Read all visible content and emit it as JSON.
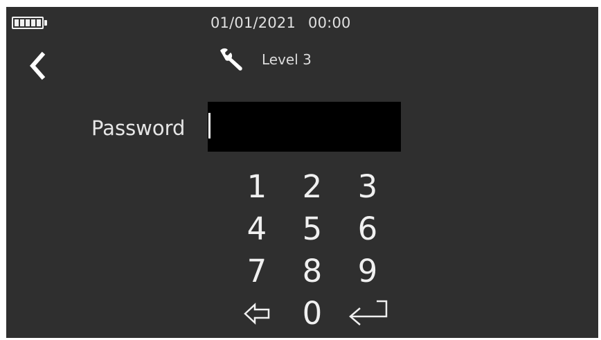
{
  "status_bar": {
    "battery_icon": "battery-full-icon",
    "date": "01/01/2021",
    "time": "00:00"
  },
  "header": {
    "back_icon": "chevron-left-icon",
    "level_icon": "wrench-icon",
    "level_label": "Level 3"
  },
  "password": {
    "label": "Password",
    "value": ""
  },
  "keypad": {
    "keys": [
      "1",
      "2",
      "3",
      "4",
      "5",
      "6",
      "7",
      "8",
      "9"
    ],
    "zero": "0",
    "backspace_icon": "backspace-arrow-icon",
    "enter_icon": "enter-return-icon"
  },
  "colors": {
    "background": "#2f2f2f",
    "text": "#e6e6e6",
    "input_background": "#000000"
  }
}
